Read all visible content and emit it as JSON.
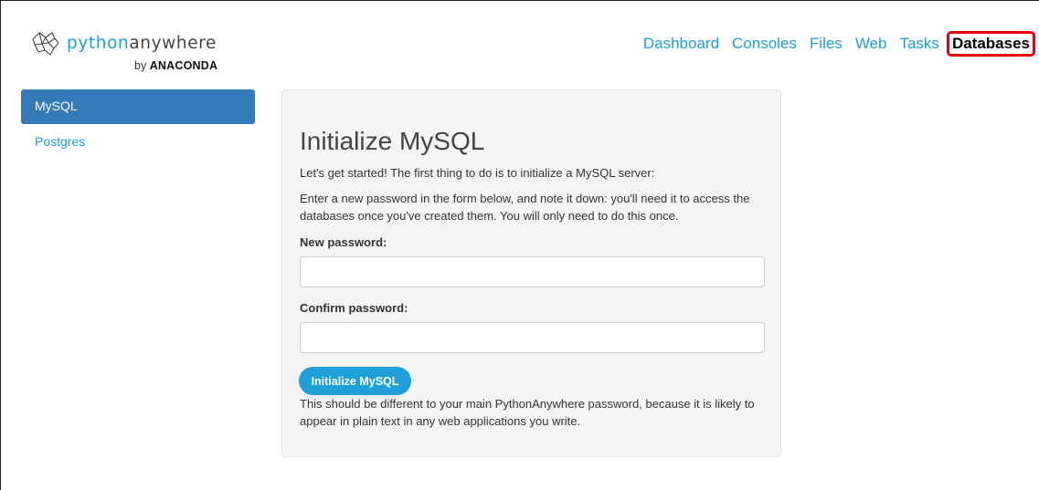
{
  "brand": {
    "python": "python",
    "anywhere": "anywhere",
    "by": "by",
    "company": "ANACONDA",
    "accent_color": "#1d9fd8",
    "icon": "pythonanywhere-logo-icon"
  },
  "nav": {
    "items": [
      {
        "label": "Dashboard"
      },
      {
        "label": "Consoles"
      },
      {
        "label": "Files"
      },
      {
        "label": "Web"
      },
      {
        "label": "Tasks"
      },
      {
        "label": "Databases",
        "active": true
      }
    ],
    "highlight_color": "#e8000d"
  },
  "sidebar": {
    "items": [
      {
        "label": "MySQL",
        "active": true
      },
      {
        "label": "Postgres"
      }
    ],
    "active_color": "#337ab7"
  },
  "main": {
    "title": "Initialize MySQL",
    "intro": "Let's get started! The first thing to do is to initialize a MySQL server:",
    "note": "Enter a new password in the form below, and note it down: you'll need it to access the databases once you've created them. You will only need to do this once.",
    "new_password_label": "New password:",
    "new_password_value": "",
    "confirm_password_label": "Confirm password:",
    "confirm_password_value": "",
    "button_label": "Initialize MySQL",
    "help": "This should be different to your main PythonAnywhere password, because it is likely to appear in plain text in any web applications you write."
  }
}
